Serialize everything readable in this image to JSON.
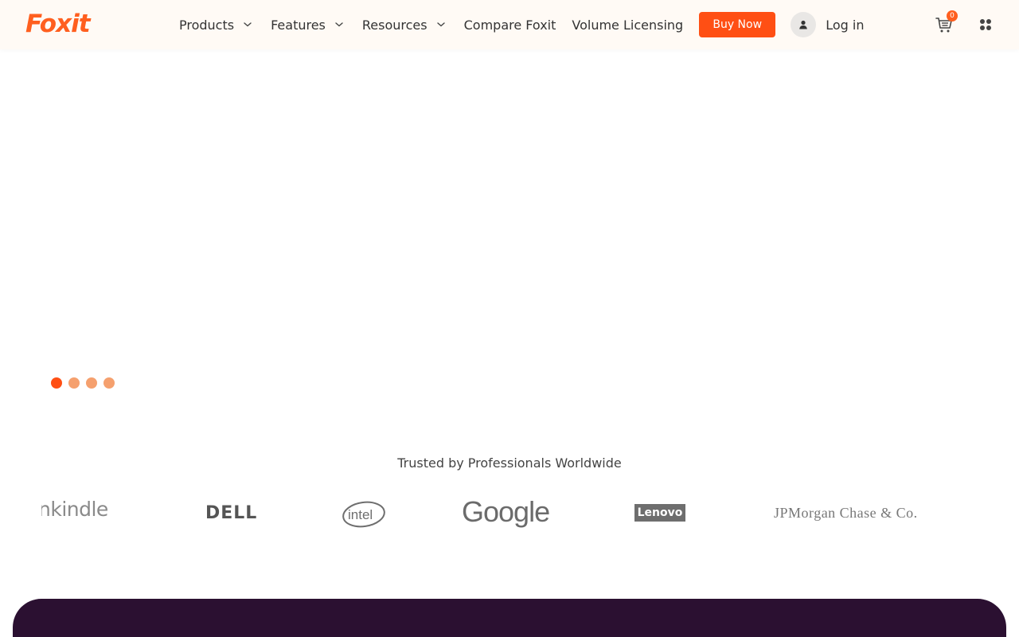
{
  "header": {
    "logo_text": "Foxit",
    "nav": [
      {
        "label": "Products",
        "has_dropdown": true
      },
      {
        "label": "Features",
        "has_dropdown": true
      },
      {
        "label": "Resources",
        "has_dropdown": true
      },
      {
        "label": "Compare Foxit",
        "has_dropdown": false
      },
      {
        "label": "Volume Licensing",
        "has_dropdown": false
      }
    ],
    "buy_label": "Buy Now",
    "login_label": "Log in",
    "cart_count": "0"
  },
  "carousel": {
    "dots": 4,
    "active_index": 0
  },
  "trusted": {
    "heading": "Trusted by Professionals Worldwide",
    "brands": [
      "kindle",
      "DELL",
      "intel",
      "Google",
      "Lenovo",
      "JPMorgan Chase & Co."
    ]
  },
  "colors": {
    "accent": "#ff4f14",
    "dot_inactive": "#f5a06e",
    "header_bg": "#fffaf5",
    "dark_panel": "#2b1031"
  }
}
